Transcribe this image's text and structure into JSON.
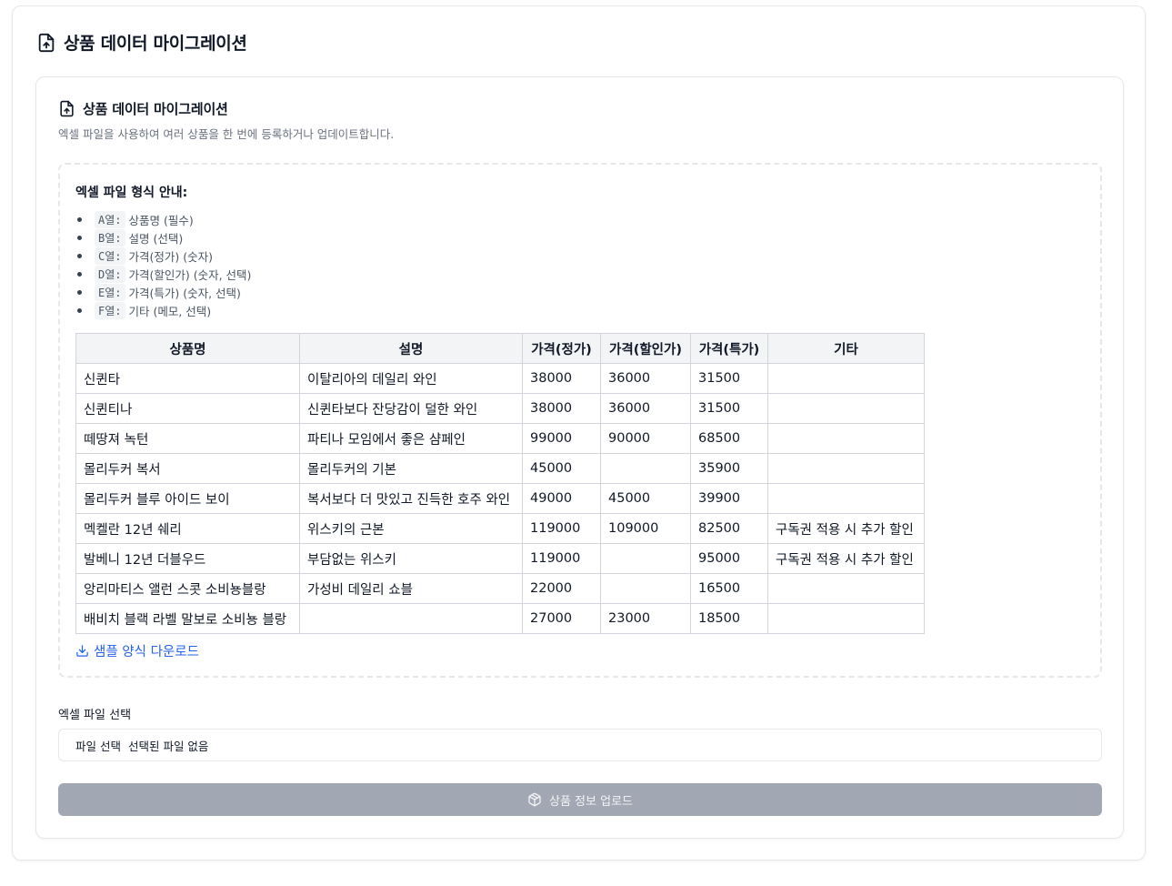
{
  "header": {
    "title": "상품 데이터 마이그레이션",
    "icon": "file-upload-icon"
  },
  "card": {
    "title": "상품 데이터 마이그레이션",
    "description": "엑셀 파일을 사용하여 여러 상품을 한 번에 등록하거나 업데이트합니다.",
    "icon": "file-upload-icon"
  },
  "guide": {
    "title": "엑셀 파일 형식 안내:",
    "items": [
      {
        "col": "A열:",
        "text": "상품명 (필수)"
      },
      {
        "col": "B열:",
        "text": "설명 (선택)"
      },
      {
        "col": "C열:",
        "text": "가격(정가) (숫자)"
      },
      {
        "col": "D열:",
        "text": "가격(할인가) (숫자, 선택)"
      },
      {
        "col": "E열:",
        "text": "가격(특가) (숫자, 선택)"
      },
      {
        "col": "F열:",
        "text": "기타 (메모, 선택)"
      }
    ]
  },
  "sample_table": {
    "headers": [
      "상품명",
      "설명",
      "가격(정가)",
      "가격(할인가)",
      "가격(특가)",
      "기타"
    ],
    "rows": [
      [
        "신퀸타",
        "이탈리아의 데일리 와인",
        "38000",
        "36000",
        "31500",
        ""
      ],
      [
        "신퀸티나",
        "신퀸타보다 잔당감이 덜한 와인",
        "38000",
        "36000",
        "31500",
        ""
      ],
      [
        "떼땅져 녹턴",
        "파티나 모임에서 좋은 샴페인",
        "99000",
        "90000",
        "68500",
        ""
      ],
      [
        "몰리두커 복서",
        "몰리두커의 기본",
        "45000",
        "",
        "35900",
        ""
      ],
      [
        "몰리두커 블루 아이드 보이",
        "복서보다 더 맛있고 진득한 호주 와인",
        "49000",
        "45000",
        "39900",
        ""
      ],
      [
        "멕켈란 12년 쉐리",
        "위스키의 근본",
        "119000",
        "109000",
        "82500",
        "구독권 적용 시 추가 할인"
      ],
      [
        "발베니 12년 더블우드",
        "부담없는 위스키",
        "119000",
        "",
        "95000",
        "구독권 적용 시 추가 할인"
      ],
      [
        "앙리마티스 앨런 스콧 소비뇽블랑",
        "가성비 데일리 쇼블",
        "22000",
        "",
        "16500",
        ""
      ],
      [
        "배비치 블랙 라벨 말보로 소비뇽 블랑",
        "",
        "27000",
        "23000",
        "18500",
        ""
      ]
    ]
  },
  "download": {
    "label": "샘플 양식 다운로드",
    "icon": "download-icon"
  },
  "file_select": {
    "label": "엑셀 파일 선택",
    "button_label": "파일 선택",
    "status": "선택된 파일 없음"
  },
  "upload_button": {
    "label": "상품 정보 업로드",
    "icon": "package-icon"
  },
  "colors": {
    "link": "#2563eb",
    "button_disabled": "#9ca3af",
    "border": "#e5e7eb"
  }
}
